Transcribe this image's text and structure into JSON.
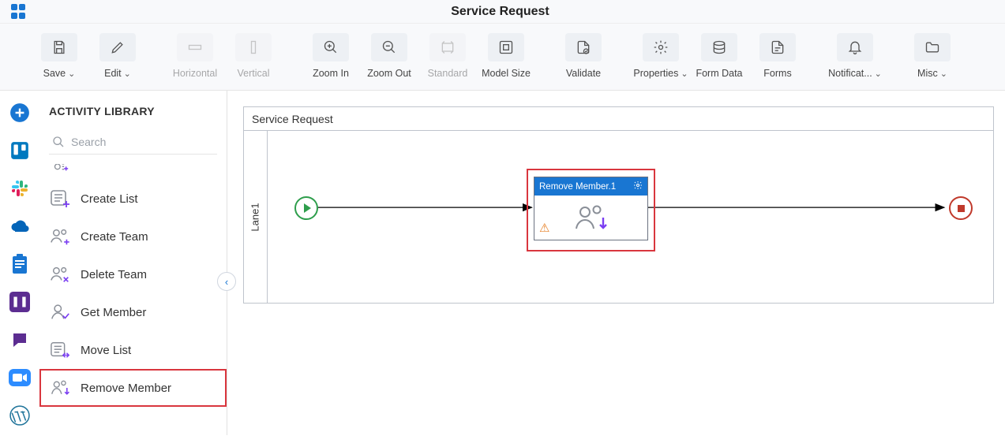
{
  "header": {
    "title": "Service Request"
  },
  "toolbar": {
    "save": "Save",
    "edit": "Edit",
    "horizontal": "Horizontal",
    "vertical": "Vertical",
    "zoomIn": "Zoom In",
    "zoomOut": "Zoom Out",
    "standard": "Standard",
    "modelSize": "Model Size",
    "validate": "Validate",
    "properties": "Properties",
    "formData": "Form Data",
    "forms": "Forms",
    "notifications": "Notificat...",
    "misc": "Misc"
  },
  "sidePanel": {
    "title": "ACTIVITY LIBRARY",
    "searchPlaceholder": "Search",
    "items": {
      "createList": "Create List",
      "createTeam": "Create Team",
      "deleteTeam": "Delete Team",
      "getMember": "Get Member",
      "moveList": "Move List",
      "removeMember": "Remove Member"
    }
  },
  "canvas": {
    "poolName": "Service Request",
    "laneName": "Lane1",
    "activity": {
      "label": "Remove Member.1"
    }
  }
}
